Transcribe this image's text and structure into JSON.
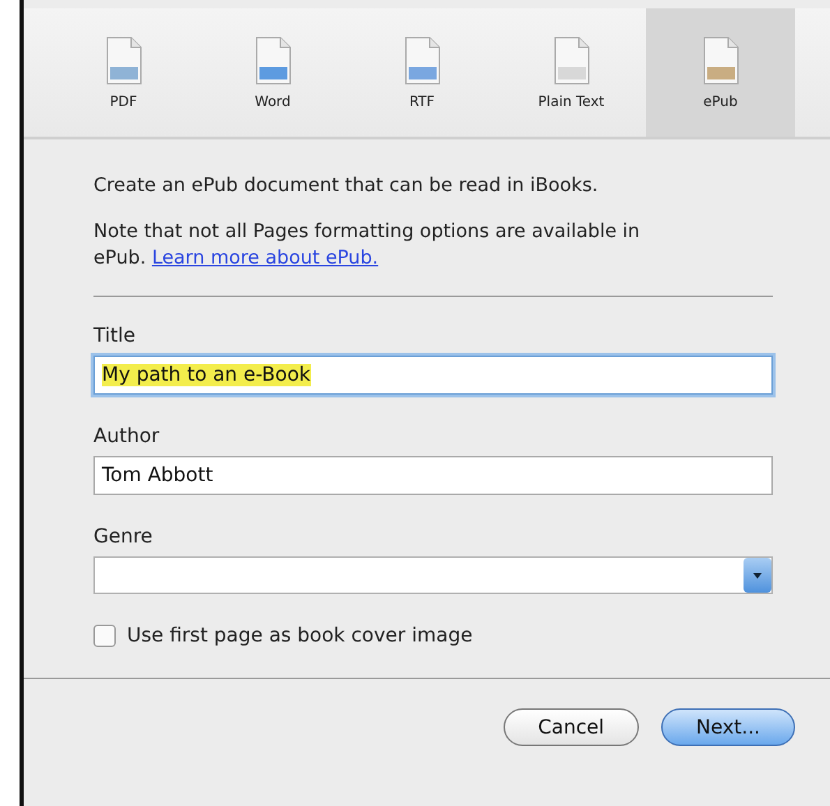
{
  "tabs": [
    {
      "label": "PDF",
      "selected": false,
      "color": "#8fb3d6"
    },
    {
      "label": "Word",
      "selected": false,
      "color": "#5d9be0"
    },
    {
      "label": "RTF",
      "selected": false,
      "color": "#7aa7e0"
    },
    {
      "label": "Plain Text",
      "selected": false,
      "color": "#d8d8d8"
    },
    {
      "label": "ePub",
      "selected": true,
      "color": "#c9ad82"
    }
  ],
  "intro": "Create an ePub document that can be read in iBooks.",
  "note": {
    "text": "Note that not all Pages formatting options are available in ePub.",
    "link": "Learn more about ePub."
  },
  "fields": [
    {
      "label": "Title",
      "kind": "text",
      "value": "My path to an e-Book",
      "focused": true
    },
    {
      "label": "Author",
      "kind": "text",
      "value": "Tom Abbott",
      "focused": false
    },
    {
      "label": "Genre",
      "kind": "select"
    }
  ],
  "cover_checkbox": {
    "label": "Use first page as book cover image",
    "checked": false
  },
  "buttons": [
    {
      "label": "Cancel",
      "default": false
    },
    {
      "label": "Next...",
      "default": true
    }
  ]
}
